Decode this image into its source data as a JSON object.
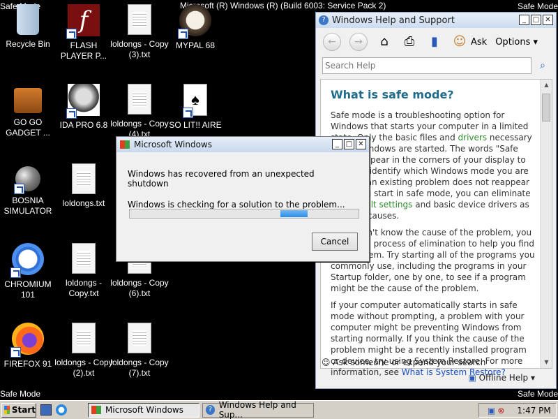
{
  "overlay": {
    "safe_mode": "Safe Mode",
    "build": "Microsoft (R) Windows (R) (Build 6003: Service Pack 2)"
  },
  "desktop_icons": [
    {
      "label": "Recycle Bin",
      "icon": "recycle-bin-icon"
    },
    {
      "label": "FLASH PLAYER P...",
      "icon": "flash-player-icon"
    },
    {
      "label": "loldongs - Copy (3).txt",
      "icon": "text-file-icon"
    },
    {
      "label": "MYPAL 68",
      "icon": "mypal-browser-icon"
    },
    {
      "label": "GO GO GADGET ...",
      "icon": "briefcase-icon"
    },
    {
      "label": "IDA PRO 6.8",
      "icon": "ida-pro-icon"
    },
    {
      "label": "loldongs - Copy (4).txt",
      "icon": "text-file-icon"
    },
    {
      "label": "SO LIT!! AIRE",
      "icon": "solitaire-icon"
    },
    {
      "label": "BOSNIA SIMULATOR",
      "icon": "mine-icon"
    },
    {
      "label": "loldongs.txt",
      "icon": "text-file-icon"
    },
    {
      "label": "CHROMIUM 101",
      "icon": "chromium-icon"
    },
    {
      "label": "loldongs - Copy.txt",
      "icon": "text-file-icon"
    },
    {
      "label": "loldongs - Copy (6).txt",
      "icon": "text-file-icon"
    },
    {
      "label": "FIREFOX 91",
      "icon": "firefox-icon"
    },
    {
      "label": "loldongs - Copy (2).txt",
      "icon": "text-file-icon"
    },
    {
      "label": "loldongs - Copy (7).txt",
      "icon": "text-file-icon"
    }
  ],
  "help": {
    "title": "Windows Help and Support",
    "ask": "Ask",
    "options": "Options",
    "search_placeholder": "Search Help",
    "heading": "What is safe mode?",
    "p1_a": "Safe mode is a troubleshooting option for Windows that starts your computer in a limited state. Only the basic files and ",
    "p1_drivers": "drivers",
    "p1_b": " necessary to run Windows are started. The words \"Safe Mode\" appear in the corners of your display to help you identify which Windows mode you are using. If an existing problem does not reappear when you start in safe mode, you can eliminate the ",
    "p1_default": "default settings",
    "p1_c": " and basic device drivers as possible causes.",
    "p2": "If you don't know the cause of the problem, you can use a process of elimination to help you find the problem. Try starting all of the programs you commonly use, including the programs in your Startup folder, one by one, to see if a program might be the cause of the problem.",
    "p3_a": "If your computer automatically starts in safe mode without prompting, a problem with your computer might be preventing Windows from starting normally. If you think the cause of the problem might be a recently installed program or device, try using System Restore. For more information, see ",
    "p3_link": "What is System Restore?",
    "ask_someone": "Ask someone or expand your search",
    "offline_help": "Offline Help"
  },
  "dialog": {
    "title": "Microsoft Windows",
    "line1": "Windows has recovered from an unexpected shutdown",
    "line2": "Windows is checking for a solution to the problem...",
    "cancel": "Cancel",
    "progress": 0.22
  },
  "taskbar": {
    "start": "Start",
    "tasks": [
      "Microsoft Windows",
      "Windows Help and Sup..."
    ],
    "clock": "1:47 PM"
  }
}
